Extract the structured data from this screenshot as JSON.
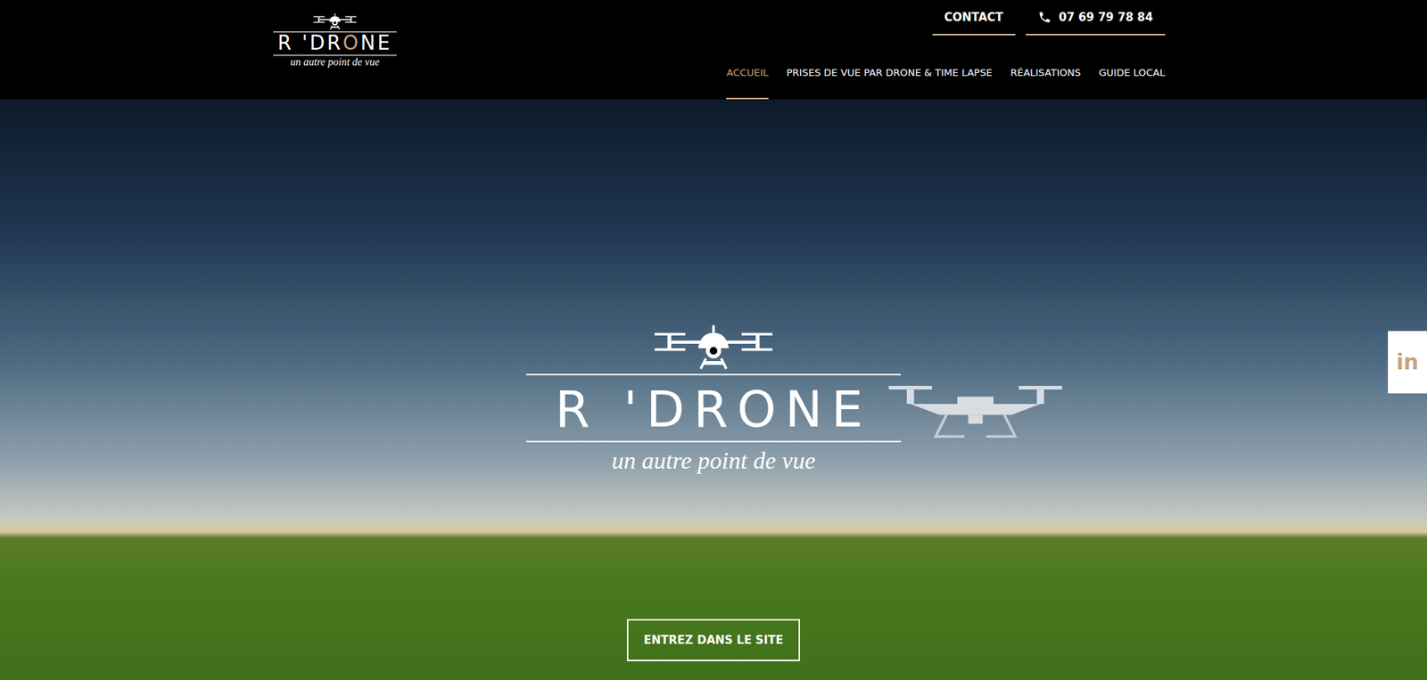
{
  "header": {
    "logo": {
      "segments": [
        {
          "text": "R 'DR",
          "accent": false
        },
        {
          "text": "O",
          "accent": true
        },
        {
          "text": "NE",
          "accent": false
        }
      ],
      "tagline": "un autre point de vue"
    },
    "contact": "CONTACT",
    "phone": "07 69 79 78 84"
  },
  "nav": [
    {
      "label": "ACCUEIL",
      "selected": true
    },
    {
      "label": "PRISES DE VUE PAR DRONE & TIME LAPSE",
      "selected": false
    },
    {
      "label": "RÉALISATIONS",
      "selected": false
    },
    {
      "label": "GUIDE LOCAL",
      "selected": false
    }
  ],
  "hero": {
    "title": "R 'DRONE",
    "tagline": "un autre point de vue",
    "button": "ENTREZ DANS LE SITE"
  },
  "social": {
    "label": "in"
  }
}
